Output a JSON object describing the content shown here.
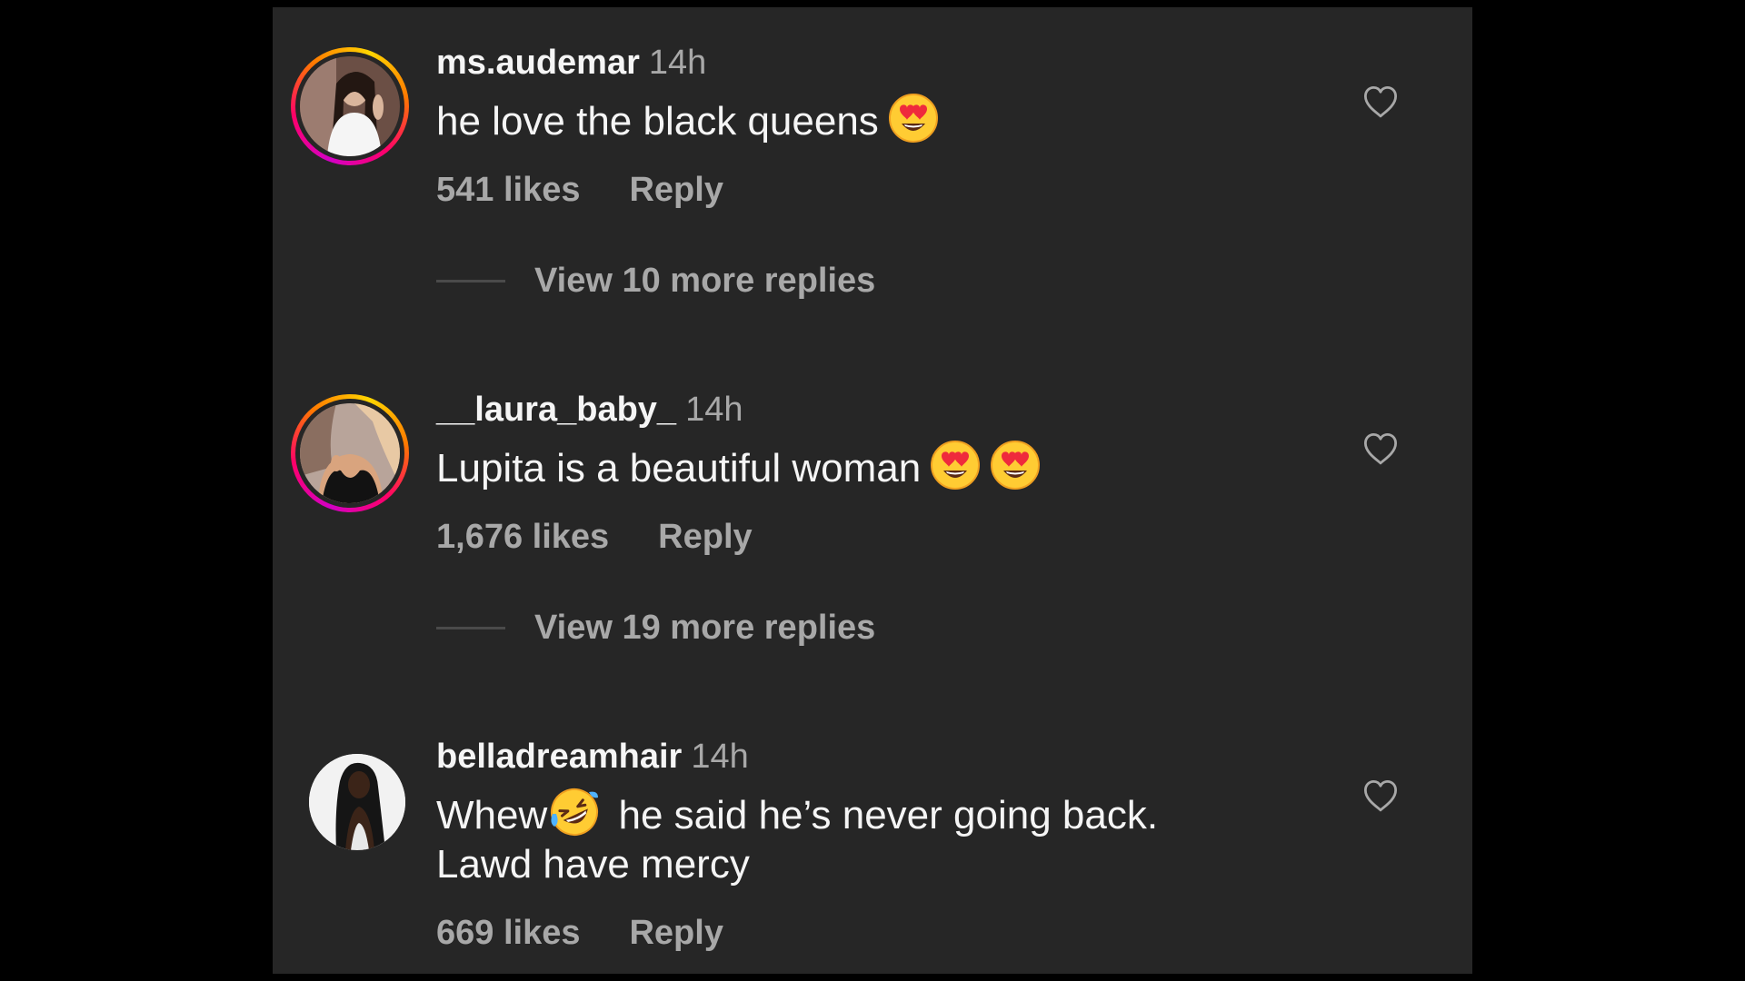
{
  "comments": [
    {
      "username": "ms.audemar",
      "time": "14h",
      "text": "he love the black queens",
      "emoji": [
        "heart-eyes-emoji"
      ],
      "likes": "541 likes",
      "reply_label": "Reply",
      "view_replies": "View 10 more replies",
      "has_story_ring": true
    },
    {
      "username": "__laura_baby_",
      "time": "14h",
      "text": "Lupita is a beautiful woman",
      "emoji": [
        "heart-eyes-emoji",
        "heart-eyes-emoji"
      ],
      "likes": "1,676 likes",
      "reply_label": "Reply",
      "view_replies": "View 19 more replies",
      "has_story_ring": true
    },
    {
      "username": "belladreamhair",
      "time": "14h",
      "text_before_emoji": "Whew",
      "text_after_emoji": " he said he’s never going back.",
      "text_line2": "Lawd have mercy",
      "emoji": [
        "rolling-on-floor-laughing-emoji"
      ],
      "likes": "669 likes",
      "reply_label": "Reply",
      "has_story_ring": false
    }
  ],
  "colors": {
    "background": "#000000",
    "panel": "#262626",
    "primary_text": "#f5f5f5",
    "secondary_text": "#a8a8a8"
  },
  "icons": {
    "like": "heart-outline-icon"
  }
}
